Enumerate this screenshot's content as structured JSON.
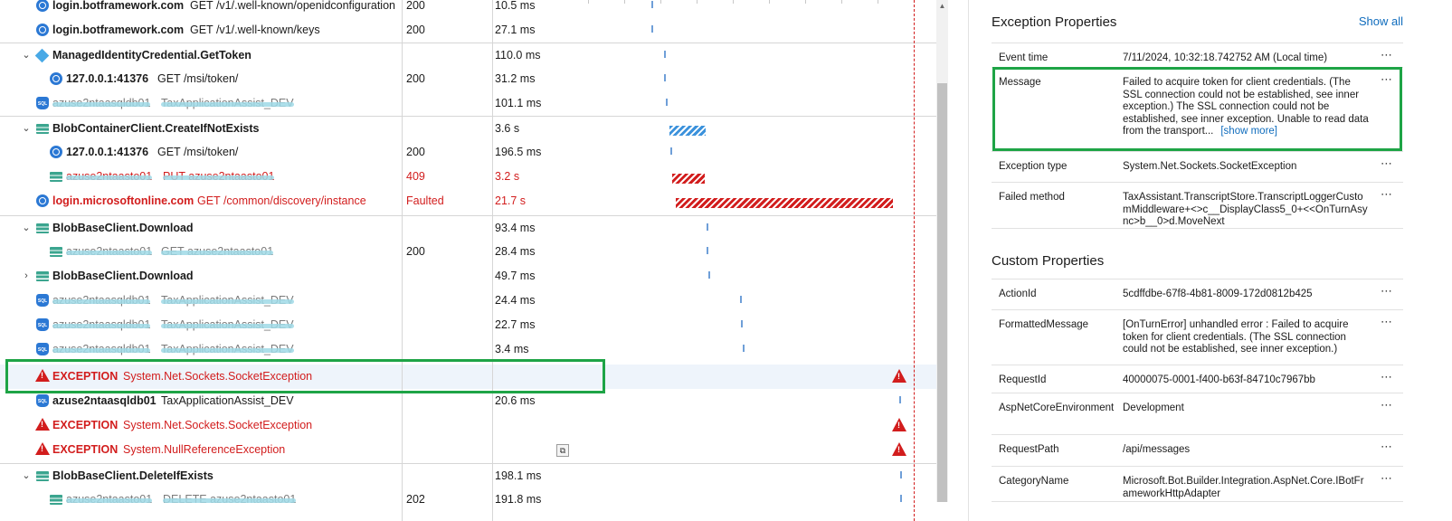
{
  "trace": {
    "rows": [
      {
        "name": "login.botframework.com",
        "detail": "GET /v1/.well-known/openidconfiguration",
        "result": "200",
        "duration": "10.5 ms"
      },
      {
        "name": "login.botframework.com",
        "detail": "GET /v1/.well-known/keys",
        "result": "200",
        "duration": "27.1 ms"
      },
      {
        "name": "ManagedIdentityCredential.GetToken",
        "duration": "110.0 ms"
      },
      {
        "name": "127.0.0.1:41376",
        "detail": "GET /msi/token/",
        "result": "200",
        "duration": "31.2 ms"
      },
      {
        "name": "azuse2ntaasqldb01",
        "detail": "TaxApplicationAssist_DEV",
        "duration": "101.1 ms"
      },
      {
        "name": "BlobContainerClient.CreateIfNotExists",
        "duration": "3.6 s"
      },
      {
        "name": "127.0.0.1:41376",
        "detail": "GET /msi/token/",
        "result": "200",
        "duration": "196.5 ms"
      },
      {
        "name": "azuse2ntaasto01",
        "detail": "PUT azuse2ntaasto01",
        "result": "409",
        "duration": "3.2 s"
      },
      {
        "name": "login.microsoftonline.com",
        "detail": "GET /common/discovery/instance",
        "result": "Faulted",
        "duration": "21.7 s"
      },
      {
        "name": "BlobBaseClient.Download",
        "duration": "93.4 ms"
      },
      {
        "name": "azuse2ntaasto01",
        "detail": "GET azuse2ntaasto01",
        "result": "200",
        "duration": "28.4 ms"
      },
      {
        "name": "BlobBaseClient.Download",
        "duration": "49.7 ms"
      },
      {
        "name": "azuse2ntaasqldb01",
        "detail": "TaxApplicationAssist_DEV",
        "duration": "24.4 ms"
      },
      {
        "name": "azuse2ntaasqldb01",
        "detail": "TaxApplicationAssist_DEV",
        "duration": "22.7 ms"
      },
      {
        "name": "azuse2ntaasqldb01",
        "detail": "TaxApplicationAssist_DEV",
        "duration": "3.4 ms"
      },
      {
        "name": "EXCEPTION",
        "detail": "System.Net.Sockets.SocketException"
      },
      {
        "name": "azuse2ntaasqldb01",
        "detail": "TaxApplicationAssist_DEV",
        "duration": "20.6 ms"
      },
      {
        "name": "EXCEPTION",
        "detail": "System.Net.Sockets.SocketException"
      },
      {
        "name": "EXCEPTION",
        "detail": "System.NullReferenceException"
      },
      {
        "name": "BlobBaseClient.DeleteIfExists",
        "duration": "198.1 ms"
      },
      {
        "name": "azuse2ntaasto01",
        "detail": "DELETE azuse2ntaasto01",
        "result": "202",
        "duration": "191.8 ms"
      }
    ]
  },
  "exception_properties": {
    "title": "Exception Properties",
    "show_all": "Show all",
    "items": [
      {
        "key": "Event time",
        "value": "7/11/2024, 10:32:18.742752 AM (Local time)"
      },
      {
        "key": "Message",
        "value": "Failed to acquire token for client credentials. (The SSL connection could not be established, see inner exception.) The SSL connection could not be established, see inner exception. Unable to read data from the transport...",
        "more": "[show more]"
      },
      {
        "key": "Exception type",
        "value": "System.Net.Sockets.SocketException"
      },
      {
        "key": "Failed method",
        "value": "TaxAssistant.TranscriptStore.TranscriptLoggerCustomMiddleware+<>c__DisplayClass5_0+<<OnTurnAsync>b__0>d.MoveNext"
      }
    ]
  },
  "custom_properties": {
    "title": "Custom Properties",
    "items": [
      {
        "key": "ActionId",
        "value": "5cdffdbe-67f8-4b81-8009-172d0812b425"
      },
      {
        "key": "FormattedMessage",
        "value": "[OnTurnError] unhandled error : Failed to acquire token for client credentials. (The SSL connection could not be established, see inner exception.)"
      },
      {
        "key": "RequestId",
        "value": "40000075-0001-f400-b63f-84710c7967bb"
      },
      {
        "key": "AspNetCoreEnvironment",
        "value": "Development"
      },
      {
        "key": "RequestPath",
        "value": "/api/messages"
      },
      {
        "key": "CategoryName",
        "value": "Microsoft.Bot.Builder.Integration.AspNet.Core.IBotFrameworkHttpAdapter"
      }
    ]
  },
  "icons": {
    "menu": "ellipsis-icon",
    "warn": "warning-triangle-icon"
  },
  "colors": {
    "error": "#d21d1d",
    "link": "#0f6cbd",
    "highlight": "#1ea446",
    "bar_blue": "#3c92dc"
  }
}
